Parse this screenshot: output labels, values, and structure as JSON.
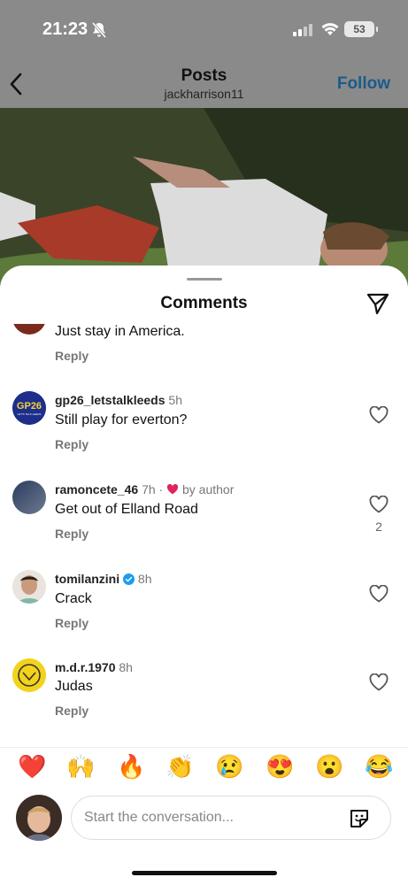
{
  "status_bar": {
    "time": "21:23",
    "battery": "53"
  },
  "post_header": {
    "title": "Posts",
    "username": "jackharrison11",
    "follow_label": "Follow"
  },
  "sheet": {
    "title": "Comments"
  },
  "comments": [
    {
      "text": "Just stay in America.",
      "reply": "Reply"
    },
    {
      "username": "gp26_letstalkleeds",
      "time": "5h",
      "text": "Still play for everton?",
      "reply": "Reply"
    },
    {
      "username": "ramoncete_46",
      "time": "7h",
      "liked_by": "by author",
      "text": "Get out of Elland Road",
      "reply": "Reply",
      "likes": "2"
    },
    {
      "username": "tomilanzini",
      "time": "8h",
      "text": "Crack",
      "reply": "Reply",
      "verified": true
    },
    {
      "username": "m.d.r.1970",
      "time": "8h",
      "text": "Judas",
      "reply": "Reply"
    }
  ],
  "avatar_text": {
    "gp26": "GP26",
    "gp26_sub": "LET'S TALK LEEDS"
  },
  "emojis": [
    "❤️",
    "🙌",
    "🔥",
    "👏",
    "😢",
    "😍",
    "😮",
    "😂"
  ],
  "compose": {
    "placeholder": "Start the conversation..."
  },
  "colors": {
    "follow": "#1a5c8a",
    "verified": "#1d9bf0",
    "heart": "#e0245e"
  }
}
